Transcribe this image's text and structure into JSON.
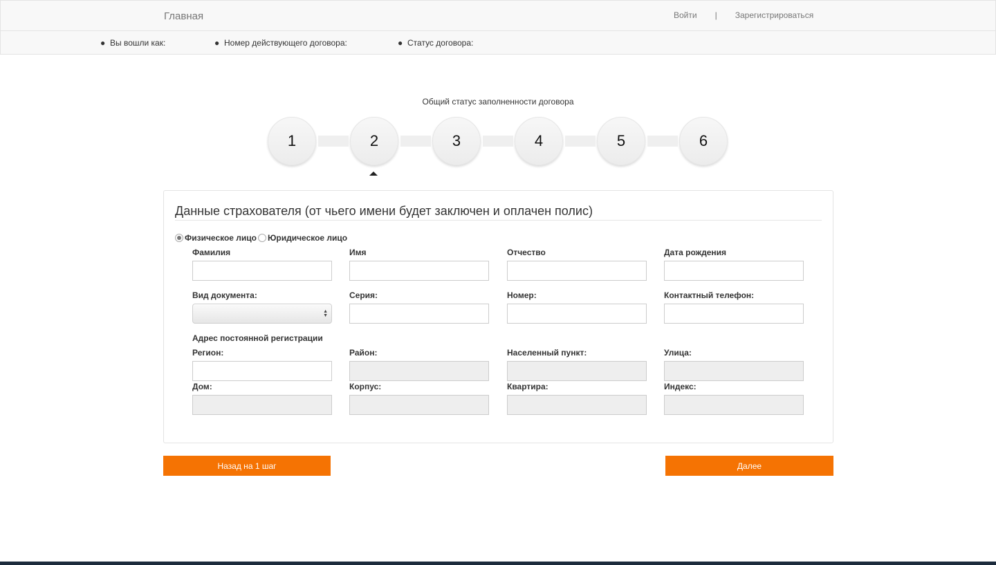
{
  "navbar": {
    "brand": "Главная",
    "login": "Войти",
    "separator": "|",
    "register": "Зарегистрироваться"
  },
  "info": {
    "logged_as": "Вы вошли как:",
    "contract_number": "Номер действующего договора:",
    "contract_status": "Статус договора:"
  },
  "progress": {
    "title": "Общий статус заполненности договора",
    "steps": [
      "1",
      "2",
      "3",
      "4",
      "5",
      "6"
    ],
    "current_step": 2
  },
  "form": {
    "title": "Данные страхователя (от чьего имени будет заключен и оплачен полис)",
    "person_types": [
      {
        "label": "Физическое лицо",
        "checked": true
      },
      {
        "label": "Юридическое лицо",
        "checked": false
      }
    ],
    "fields": {
      "last_name": {
        "label": "Фамилия",
        "value": ""
      },
      "first_name": {
        "label": "Имя",
        "value": ""
      },
      "middle_name": {
        "label": "Отчество",
        "value": ""
      },
      "birth_date": {
        "label": "Дата рождения",
        "value": ""
      },
      "doc_type": {
        "label": "Вид документа:",
        "value": ""
      },
      "series": {
        "label": "Серия:",
        "value": ""
      },
      "number": {
        "label": "Номер:",
        "value": ""
      },
      "phone": {
        "label": "Контактный телефон:",
        "value": ""
      }
    },
    "address_title": "Адрес постоянной регистрации",
    "address": {
      "region": {
        "label": "Регион:",
        "value": ""
      },
      "district": {
        "label": "Район:",
        "value": ""
      },
      "locality": {
        "label": "Населенный пункт:",
        "value": ""
      },
      "street": {
        "label": "Улица:",
        "value": ""
      },
      "house": {
        "label": "Дом:",
        "value": ""
      },
      "building": {
        "label": "Корпус:",
        "value": ""
      },
      "apartment": {
        "label": "Квартира:",
        "value": ""
      },
      "index": {
        "label": "Индекс:",
        "value": ""
      }
    }
  },
  "buttons": {
    "back": "Назад на 1 шаг",
    "next": "Далее"
  },
  "colors": {
    "accent": "#f57303",
    "disabled_input": "#eeeeee",
    "navbar_bg": "#f8f8f8"
  }
}
